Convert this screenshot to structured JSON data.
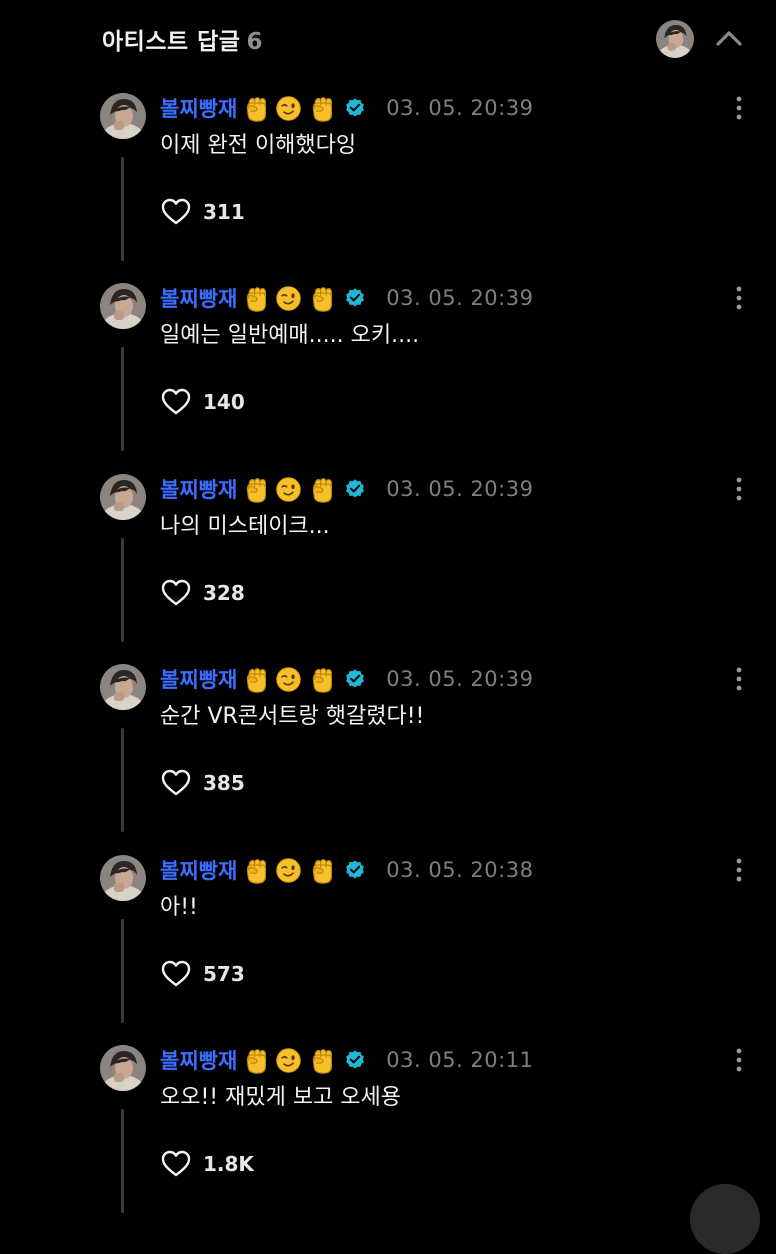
{
  "header": {
    "title": "아티스트 답글",
    "count": "6"
  },
  "replies": [
    {
      "author": "볼찌빵재",
      "timestamp": "03. 05. 20:39",
      "content": "이제 완전 이해했다잉",
      "likes": "311"
    },
    {
      "author": "볼찌빵재",
      "timestamp": "03. 05. 20:39",
      "content": "일예는 일반예매..... 오키....",
      "likes": "140"
    },
    {
      "author": "볼찌빵재",
      "timestamp": "03. 05. 20:39",
      "content": "나의 미스테이크...",
      "likes": "328"
    },
    {
      "author": "볼찌빵재",
      "timestamp": "03. 05. 20:39",
      "content": "순간 VR콘서트랑 햇갈렸다!!",
      "likes": "385"
    },
    {
      "author": "볼찌빵재",
      "timestamp": "03. 05. 20:38",
      "content": "아!!",
      "likes": "573"
    },
    {
      "author": "볼찌빵재",
      "timestamp": "03. 05. 20:11",
      "content": "오오!! 재밌게 보고 오세용",
      "likes": "1.8K"
    }
  ],
  "author_emojis": [
    "raised-fist",
    "winking-face",
    "raised-fist"
  ],
  "colors": {
    "background": "#000000",
    "author": "#3b6dff",
    "verified": "#1fb8d6",
    "timestamp": "#7f7f7f"
  }
}
